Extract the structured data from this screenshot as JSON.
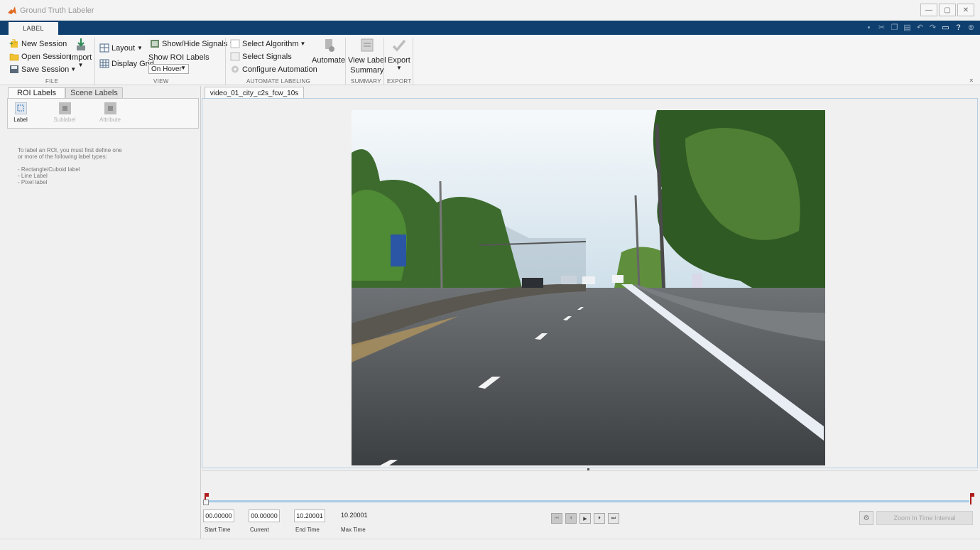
{
  "app": {
    "title": "Ground Truth Labeler"
  },
  "window_controls": {
    "minimize": "—",
    "maximize": "▢",
    "close": "✕"
  },
  "tabs": {
    "active": "LABEL"
  },
  "ribbon": {
    "file": {
      "new_session": "New Session",
      "open_session": "Open Session",
      "save_session": "Save Session",
      "import": "Import",
      "label": "FILE"
    },
    "view": {
      "layout": "Layout",
      "display_grid": "Display Grid",
      "show_hide_signals": "Show/Hide Signals",
      "show_roi_labels": "Show ROI Labels",
      "roi_labels_option": "On Hover",
      "label": "VIEW"
    },
    "automate": {
      "select_algorithm": "Select Algorithm",
      "select_signals": "Select Signals",
      "configure_automation": "Configure Automation",
      "automate": "Automate",
      "label": "AUTOMATE LABELING"
    },
    "summary": {
      "view_label": "View Label",
      "summary": "Summary",
      "label": "SUMMARY"
    },
    "export": {
      "export": "Export",
      "label": "EXPORT"
    }
  },
  "left_panel": {
    "tabs": [
      "ROI Labels",
      "Scene Labels"
    ],
    "buttons": {
      "label": "Label",
      "sublabel": "Sublabel",
      "attribute": "Attribute"
    },
    "help_lines": [
      "To label an ROI, you must first define one",
      "or more of the following label types:",
      "",
      "- Rectangle/Cuboid label",
      "- Line Label",
      "- Pixel label"
    ]
  },
  "video": {
    "tab": "video_01_city_c2s_fcw_10s"
  },
  "timeline": {
    "start_time": "00.00000",
    "current": "00.00000",
    "end_time": "10.20001",
    "max_time": "10.20001",
    "captions": {
      "start": "Start Time",
      "current": "Current",
      "end": "End Time",
      "max": "Max Time"
    },
    "zoom_button": "Zoom In Time Interval"
  },
  "colors": {
    "accent": "#0e3f6e",
    "flag": "#b01b1b",
    "track": "#a9cbe6"
  }
}
